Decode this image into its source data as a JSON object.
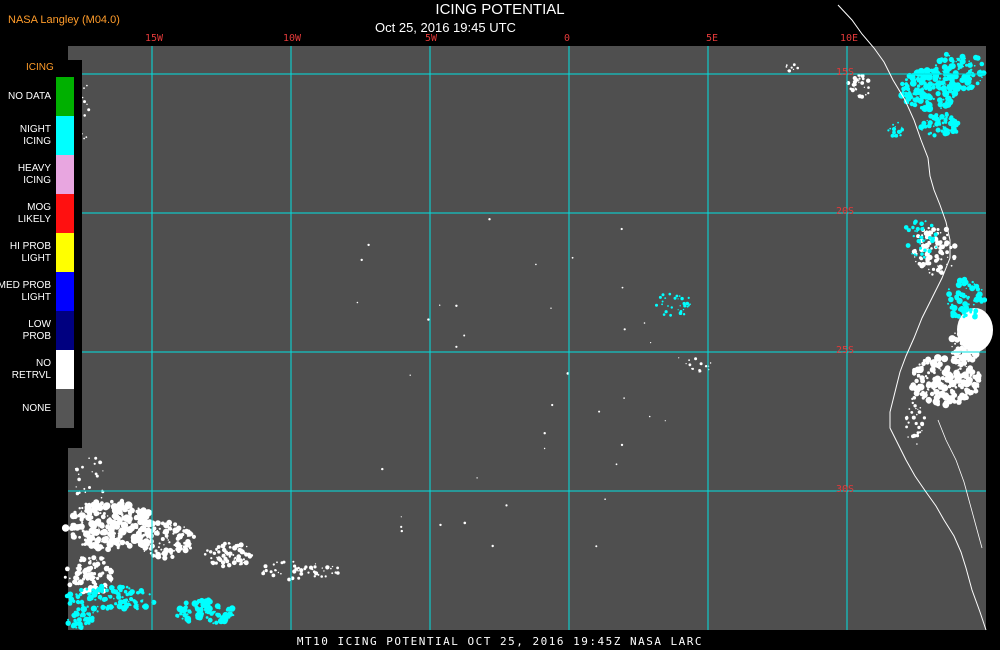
{
  "header": {
    "producer": "NASA Langley (M04.0)",
    "title": "ICING POTENTIAL",
    "datetime": "Oct 25, 2016 19:45 UTC"
  },
  "map": {
    "colors": {
      "background": "#4f4f4f",
      "grid": "#00e1e1",
      "coastline": "#ffffff",
      "label": "#e23a3a",
      "night_icing": "#00ffff",
      "no_retrieval": "#ffffff"
    },
    "longitude_labels": [
      "15W",
      "10W",
      "5W",
      "0",
      "5E",
      "10E"
    ],
    "latitude_labels": [
      "15S",
      "20S",
      "25S",
      "30S"
    ]
  },
  "legend": {
    "title": "ICING",
    "items": [
      {
        "label": "NO DATA",
        "color": "#00b000"
      },
      {
        "label": "NIGHT\nICING",
        "color": "#00ffff"
      },
      {
        "label": "HEAVY\nICING",
        "color": "#e8a6e0"
      },
      {
        "label": "MOG\nLIKELY",
        "color": "#ff1010"
      },
      {
        "label": "HI PROB\nLIGHT",
        "color": "#ffff00"
      },
      {
        "label": "MED PROB\nLIGHT",
        "color": "#0000ff"
      },
      {
        "label": "LOW\nPROB",
        "color": "#000080"
      },
      {
        "label": "NO\nRETRVL",
        "color": "#ffffff"
      },
      {
        "label": "NONE",
        "color": "#555555"
      }
    ]
  },
  "footer": {
    "text": "MT10  ICING POTENTIAL   OCT 25, 2016 19:45Z   NASA LARC"
  }
}
